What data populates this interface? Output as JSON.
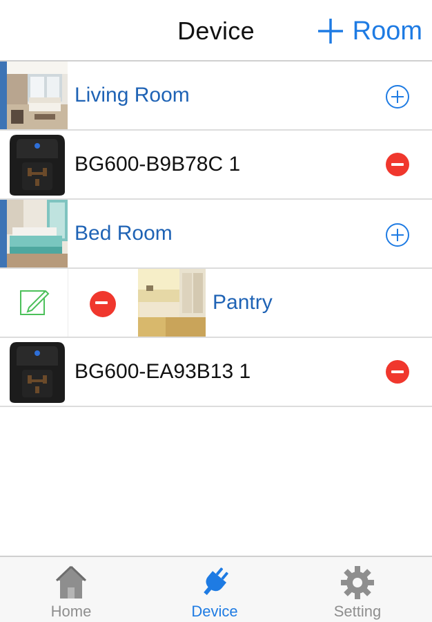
{
  "nav": {
    "title": "Device",
    "add_room_label": "Room"
  },
  "rows": [
    {
      "type": "room",
      "label": "Living Room"
    },
    {
      "type": "device",
      "label": "BG600-B9B78C 1"
    },
    {
      "type": "room",
      "label": "Bed Room"
    },
    {
      "type": "room",
      "label": "Pantry",
      "state": "swiped"
    },
    {
      "type": "device",
      "label": "BG600-EA93B13 1"
    }
  ],
  "tabs": [
    {
      "label": "Home",
      "icon": "home-icon",
      "active": false
    },
    {
      "label": "Device",
      "icon": "plug-icon",
      "active": true
    },
    {
      "label": "Setting",
      "icon": "gear-icon",
      "active": false
    }
  ],
  "colors": {
    "accent": "#1e7be3",
    "room_text": "#1f63b5",
    "room_bar": "#3d74b5",
    "delete": "#f0372d",
    "edit": "#4cc05a",
    "tab_inactive": "#8e8e8e"
  }
}
